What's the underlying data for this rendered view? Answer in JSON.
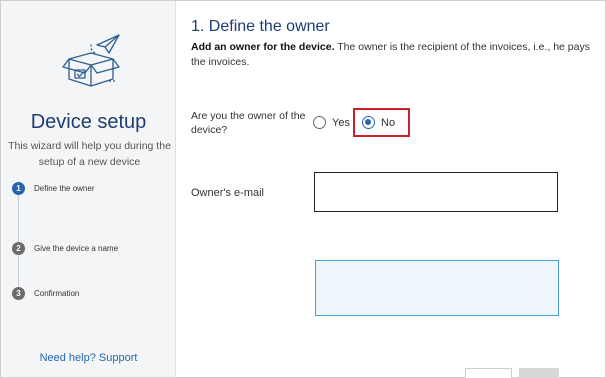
{
  "sidebar": {
    "title": "Device setup",
    "description": "This wizard will help you during the setup of a new device",
    "steps": [
      {
        "number": "1",
        "label": "Define the owner"
      },
      {
        "number": "2",
        "label": "Give the device a name"
      },
      {
        "number": "3",
        "label": "Confirmation"
      }
    ],
    "help_link": "Need help? Support"
  },
  "main": {
    "title": "1. Define the owner",
    "description_bold": "Add an owner for the device.",
    "description_rest": " The owner is the recipient of the invoices, i.e., he pays the invoices.",
    "owner_question": "Are you the owner of the device?",
    "options": [
      {
        "label": "Yes",
        "selected": false
      },
      {
        "label": "No",
        "selected": true
      }
    ],
    "email_label": "Owner's e-mail",
    "email_value": "",
    "notes_value": ""
  },
  "colors": {
    "accent": "#2566b0",
    "title": "#1f3d73",
    "highlight": "#cc1f2a"
  },
  "icons": {
    "logo": "box-paper-plane-icon"
  }
}
